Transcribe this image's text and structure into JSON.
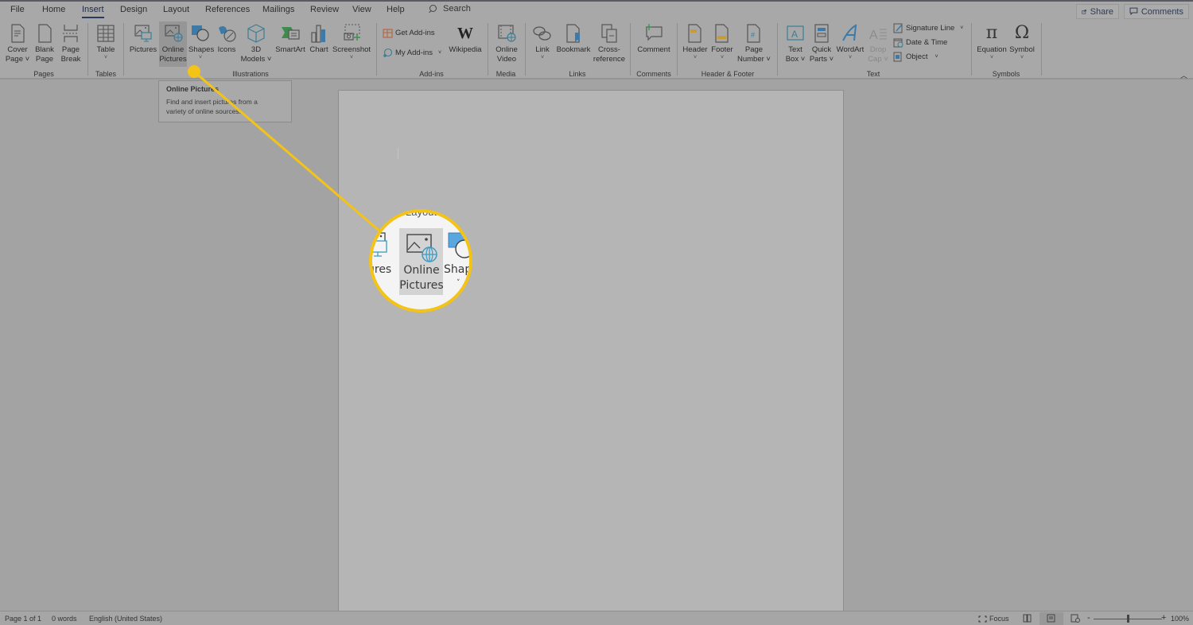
{
  "menubar": {
    "tabs": [
      {
        "label": "File"
      },
      {
        "label": "Home"
      },
      {
        "label": "Insert",
        "active": true
      },
      {
        "label": "Design"
      },
      {
        "label": "Layout"
      },
      {
        "label": "References"
      },
      {
        "label": "Mailings"
      },
      {
        "label": "Review"
      },
      {
        "label": "View"
      },
      {
        "label": "Help"
      }
    ],
    "search_label": "Search",
    "share_label": "Share",
    "comments_label": "Comments"
  },
  "ribbon": {
    "groups": {
      "pages": "Pages",
      "tables": "Tables",
      "illustrations": "Illustrations",
      "addins": "Add-ins",
      "media": "Media",
      "links": "Links",
      "comments": "Comments",
      "header_footer": "Header & Footer",
      "text": "Text",
      "symbols": "Symbols"
    },
    "buttons": {
      "cover_page": [
        "Cover",
        "Page ˅"
      ],
      "blank_page": [
        "Blank",
        "Page"
      ],
      "page_break": [
        "Page",
        "Break"
      ],
      "table": "Table",
      "pictures": "Pictures",
      "online_pictures": [
        "Online",
        "Pictures"
      ],
      "shapes": "Shapes",
      "icons": "Icons",
      "models_3d": [
        "3D",
        "Models ˅"
      ],
      "smartart": "SmartArt",
      "chart": "Chart",
      "screenshot": "Screenshot",
      "get_addins": "Get Add-ins",
      "my_addins": "My Add-ins",
      "wikipedia": "Wikipedia",
      "online_video": [
        "Online",
        "Video"
      ],
      "link": "Link",
      "bookmark": "Bookmark",
      "cross_reference": [
        "Cross-",
        "reference"
      ],
      "comment": "Comment",
      "header": "Header",
      "footer": "Footer",
      "page_number": [
        "Page",
        "Number ˅"
      ],
      "text_box": [
        "Text",
        "Box ˅"
      ],
      "quick_parts": [
        "Quick",
        "Parts ˅"
      ],
      "wordart": "WordArt",
      "drop_cap": [
        "Drop",
        "Cap ˅"
      ],
      "signature_line": "Signature Line",
      "date_time": "Date & Time",
      "object": "Object",
      "equation": "Equation",
      "symbol": "Symbol"
    }
  },
  "tooltip": {
    "title": "Online Pictures",
    "body_line1": "Find and insert pictures from a",
    "body_line2": "variety of online sources."
  },
  "callout": {
    "partial_left": "ures",
    "center_line1": "Online",
    "center_line2": "Pictures",
    "partial_right": "Shape",
    "partial_top": "Layout",
    "accent_color": "#f3c318"
  },
  "statusbar": {
    "page": "Page 1 of 1",
    "words": "0 words",
    "language": "English (United States)",
    "focus": "Focus",
    "zoom_minus": "-",
    "zoom_plus": "+",
    "zoom_level": "100%",
    "zoom_fraction": 0.5
  }
}
